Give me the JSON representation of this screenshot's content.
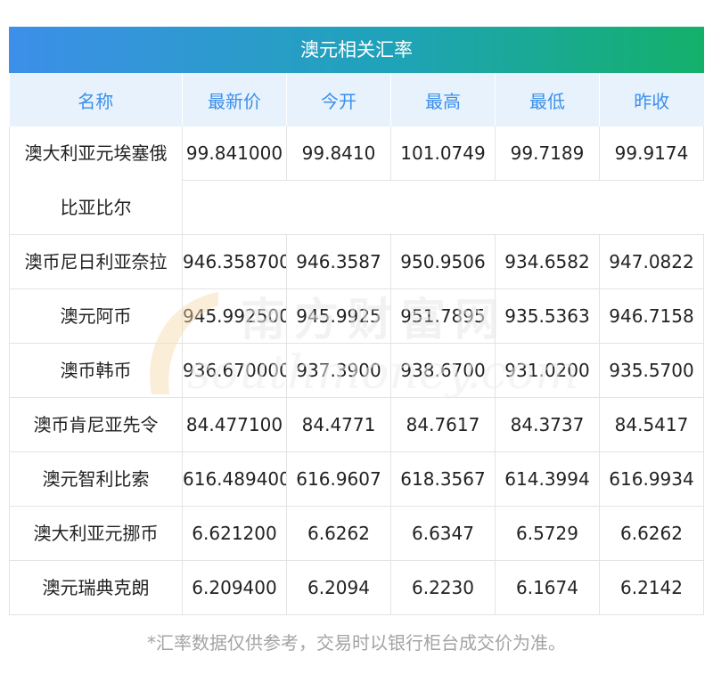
{
  "header": {
    "title": "澳元相关汇率"
  },
  "table": {
    "columns": [
      "名称",
      "最新价",
      "今开",
      "最高",
      "最低",
      "昨收"
    ],
    "rows": [
      {
        "name": "澳大利亚元埃塞俄比亚比尔",
        "name_line1": "澳大利亚元埃塞俄",
        "name_line2": "比亚比尔",
        "latest": "99.841000",
        "open": "99.8410",
        "high": "101.0749",
        "low": "99.7189",
        "prev_close": "99.9174"
      },
      {
        "name": "澳币尼日利亚奈拉",
        "latest": "946.358700",
        "open": "946.3587",
        "high": "950.9506",
        "low": "934.6582",
        "prev_close": "947.0822"
      },
      {
        "name": "澳元阿币",
        "latest": "945.992500",
        "open": "945.9925",
        "high": "951.7895",
        "low": "935.5363",
        "prev_close": "946.7158"
      },
      {
        "name": "澳币韩币",
        "latest": "936.670000",
        "open": "937.3900",
        "high": "938.6700",
        "low": "931.0200",
        "prev_close": "935.5700"
      },
      {
        "name": "澳币肯尼亚先令",
        "latest": "84.477100",
        "open": "84.4771",
        "high": "84.7617",
        "low": "84.3737",
        "prev_close": "84.5417"
      },
      {
        "name": "澳元智利比索",
        "latest": "616.489400",
        "open": "616.9607",
        "high": "618.3567",
        "low": "614.3994",
        "prev_close": "616.9934"
      },
      {
        "name": "澳大利亚元挪币",
        "latest": "6.621200",
        "open": "6.6262",
        "high": "6.6347",
        "low": "6.5729",
        "prev_close": "6.6262"
      },
      {
        "name": "澳元瑞典克朗",
        "latest": "6.209400",
        "open": "6.2094",
        "high": "6.2230",
        "low": "6.1674",
        "prev_close": "6.2142"
      }
    ]
  },
  "footnote": "*汇率数据仅供参考，交易时以银行柜台成交价为准。",
  "watermark": {
    "logo_text": "南方财富网",
    "logo_url_text": "southmoney.com"
  },
  "colors": {
    "header_start": "#3d8fe9",
    "header_end": "#14b06a",
    "column_header_text": "#3b8fe9",
    "column_header_bg": "#e7f2fd"
  }
}
